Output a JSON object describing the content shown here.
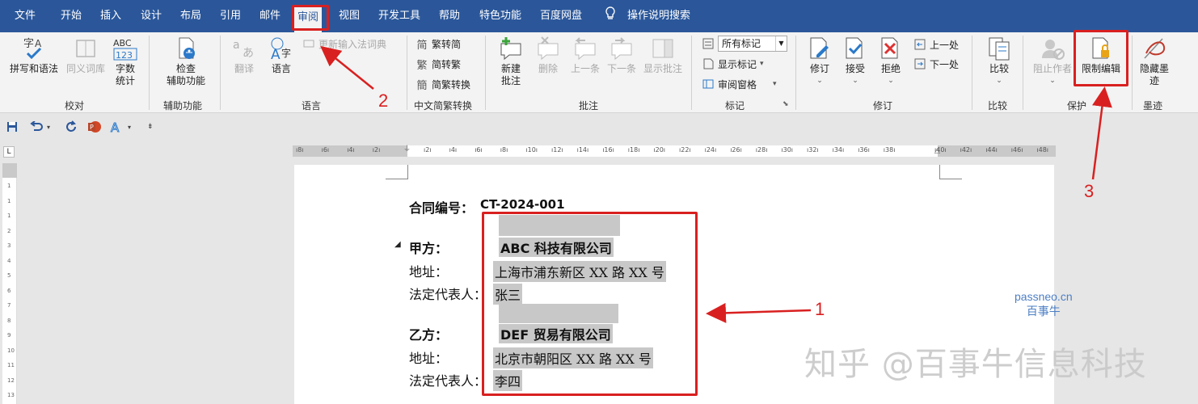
{
  "menu": {
    "tabs": [
      "文件",
      "开始",
      "插入",
      "设计",
      "布局",
      "引用",
      "邮件",
      "审阅",
      "视图",
      "开发工具",
      "帮助",
      "特色功能",
      "百度网盘"
    ],
    "active_tab": "审阅",
    "tell_me": "操作说明搜索"
  },
  "ribbon": {
    "proofing": {
      "spell_line1": "拼写和语法",
      "thesaurus": "同义词库",
      "wordcount_line1": "字数",
      "wordcount_line2": "统计",
      "group": "校对"
    },
    "accessibility": {
      "check_line1": "检查",
      "check_line2": "辅助功能",
      "group": "辅助功能"
    },
    "language": {
      "update_ime": "更新输入法词典",
      "translate": "翻译",
      "language": "语言",
      "group": "语言"
    },
    "chinese_conv": {
      "to_simplified": "繁转简",
      "to_traditional": "简转繁",
      "convert": "简繁转换",
      "group": "中文简繁转换"
    },
    "comments": {
      "new_line1": "新建",
      "new_line2": "批注",
      "delete": "删除",
      "previous": "上一条",
      "next": "下一条",
      "show": "显示批注",
      "group": "批注"
    },
    "tracking": {
      "all_markup": "所有标记",
      "show_markup": "显示标记",
      "reviewing_pane": "审阅窗格",
      "group": "标记"
    },
    "changes": {
      "track": "修订",
      "accept": "接受",
      "reject": "拒绝",
      "previous": "上一处",
      "next": "下一处",
      "group": "修订"
    },
    "compare": {
      "compare": "比较",
      "group": "比较"
    },
    "protect": {
      "block_authors": "阻止作者",
      "restrict_editing": "限制编辑",
      "group": "保护"
    },
    "ink": {
      "hide_line1": "隐藏墨",
      "hide_line2": "迹",
      "group": "墨迹"
    }
  },
  "ruler": {
    "h_ticks": [
      "8",
      "6",
      "4",
      "2",
      "",
      "2",
      "4",
      "6",
      "8",
      "10",
      "12",
      "14",
      "16",
      "18",
      "20",
      "22",
      "24",
      "26",
      "28",
      "30",
      "32",
      "34",
      "36",
      "38",
      "",
      "40",
      "42",
      "44",
      "46",
      "48"
    ],
    "v_ticks": [
      "1",
      "1",
      "1",
      "2",
      "3",
      "4",
      "5",
      "6",
      "7",
      "8",
      "9",
      "10",
      "11",
      "12",
      "13",
      "14"
    ]
  },
  "document": {
    "contract_no_label": "合同编号：",
    "contract_no": "CT-2024-001",
    "party_a_label": "甲方：",
    "party_a_name": "ABC 科技有限公司",
    "party_a_addr_label": "地址：",
    "party_a_addr": "上海市浦东新区 XX 路 XX 号",
    "party_a_rep_label": "法定代表人：",
    "party_a_rep": "张三",
    "party_b_label": "乙方：",
    "party_b_name": "DEF 贸易有限公司",
    "party_b_addr_label": "地址：",
    "party_b_addr": "北京市朝阳区 XX 路 XX 号",
    "party_b_rep_label": "法定代表人：",
    "party_b_rep": "李四"
  },
  "annotations": {
    "n1": "1",
    "n2": "2",
    "n3": "3"
  },
  "watermark": {
    "site": "passneo.cn",
    "brand": "百事牛",
    "zhihu": "知乎 @百事牛信息科技"
  },
  "colors": {
    "ribbon_blue": "#2b579a",
    "annotation_red": "#d92020",
    "highlight_grey": "#c8c8c8"
  }
}
